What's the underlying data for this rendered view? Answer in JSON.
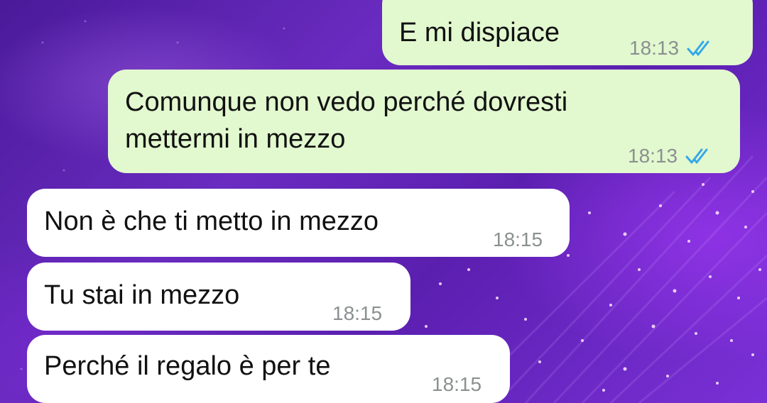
{
  "chat": {
    "messages": [
      {
        "direction": "outgoing",
        "text": "E mi dispiace",
        "time": "18:13",
        "status_icon": "double-check-read-icon"
      },
      {
        "direction": "outgoing",
        "text_lines": [
          "Comunque non vedo perché dovresti",
          "mettermi in mezzo"
        ],
        "time": "18:13",
        "status_icon": "double-check-read-icon"
      },
      {
        "direction": "incoming",
        "text": "Non è che ti metto in mezzo",
        "time": "18:15"
      },
      {
        "direction": "incoming",
        "text": "Tu stai in mezzo",
        "time": "18:15"
      },
      {
        "direction": "incoming",
        "text": "Perché il regalo è per te",
        "time": "18:15"
      }
    ]
  },
  "colors": {
    "outgoing_bubble": "#e2f8cf",
    "incoming_bubble": "#ffffff",
    "read_ticks": "#34a9e8",
    "background": "#5b1fb0"
  }
}
